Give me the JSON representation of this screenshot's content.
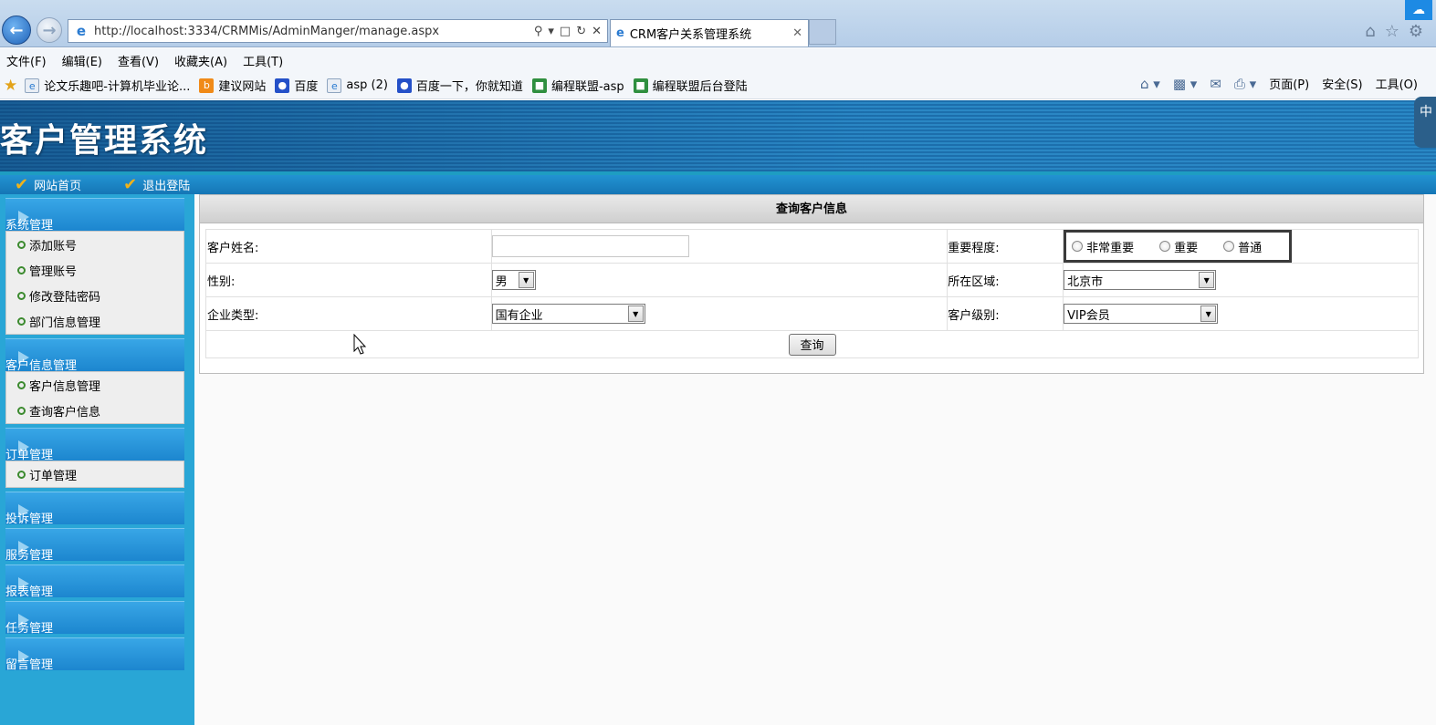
{
  "browser": {
    "url": "http://localhost:3334/CRMMis/AdminManger/manage.aspx",
    "tab_title": "CRM客户关系管理系统",
    "menu": [
      "文件(F)",
      "编辑(E)",
      "查看(V)",
      "收藏夹(A)",
      "工具(T)"
    ],
    "favorites": [
      "论文乐趣吧-计算机毕业论...",
      "建议网站",
      "百度",
      "asp (2)",
      "百度一下，你就知道",
      "编程联盟-asp",
      "编程联盟后台登陆"
    ],
    "commands": [
      "页面(P)",
      "安全(S)",
      "工具(O)"
    ]
  },
  "app": {
    "banner_title": "客户管理系统",
    "topnav": [
      "网站首页",
      "退出登陆"
    ]
  },
  "sidebar": {
    "sections": [
      {
        "title": "系统管理",
        "items": [
          "添加账号",
          "管理账号",
          "修改登陆密码",
          "部门信息管理"
        ]
      },
      {
        "title": "客户信息管理",
        "items": [
          "客户信息管理",
          "查询客户信息"
        ]
      },
      {
        "title": "订单管理",
        "items": [
          "订单管理"
        ]
      },
      {
        "title": "投诉管理",
        "items": []
      },
      {
        "title": "服务管理",
        "items": []
      },
      {
        "title": "报表管理",
        "items": []
      },
      {
        "title": "任务管理",
        "items": []
      },
      {
        "title": "留言管理",
        "items": []
      }
    ]
  },
  "query": {
    "panel_title": "查询客户信息",
    "name_label": "客户姓名:",
    "name_value": "",
    "importance_label": "重要程度:",
    "importance_options": [
      "非常重要",
      "重要",
      "普通"
    ],
    "gender_label": "性别:",
    "gender_value": "男",
    "region_label": "所在区域:",
    "region_value": "北京市",
    "company_type_label": "企业类型:",
    "company_type_value": "国有企业",
    "level_label": "客户级别:",
    "level_value": "VIP会员",
    "submit_label": "查询"
  }
}
